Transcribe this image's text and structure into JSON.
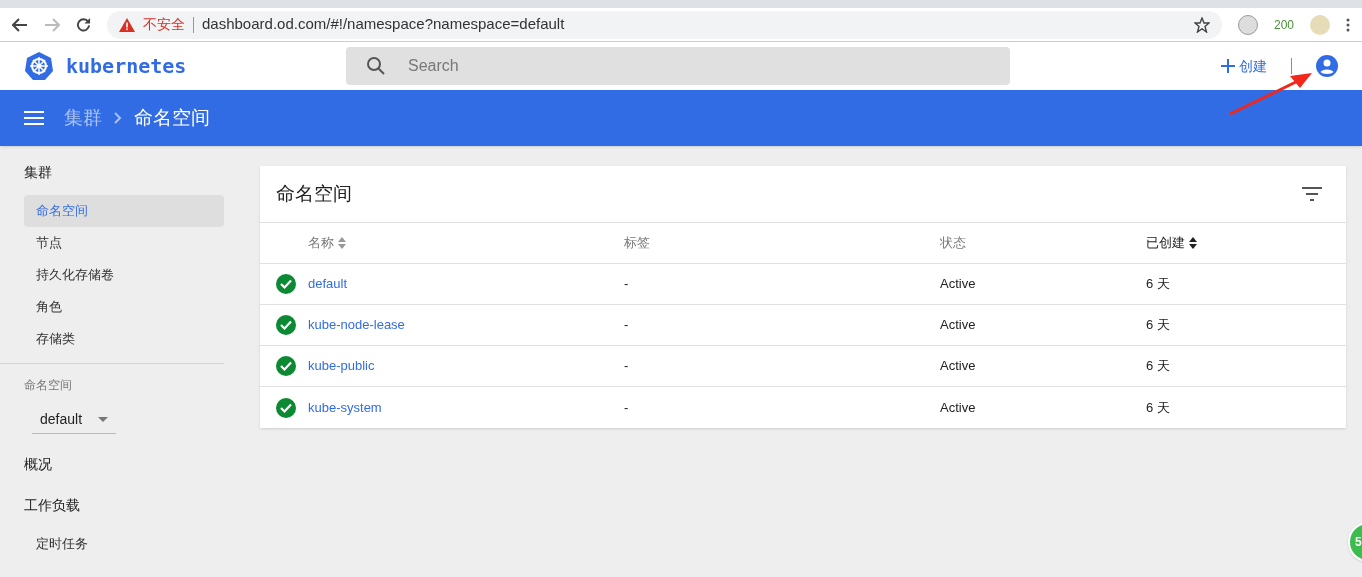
{
  "browser": {
    "security": "不安全",
    "url": "dashboard.od.com/#!/namespace?namespace=default",
    "extension_count": "200"
  },
  "header": {
    "logo": "kubernetes",
    "search": {
      "placeholder": "Search"
    },
    "create": "创建"
  },
  "breadcrumb": [
    "集群",
    "命名空间"
  ],
  "sidebar": {
    "groups": [
      {
        "title": "集群",
        "items": [
          {
            "label": "命名空间",
            "selected": true
          },
          {
            "label": "节点",
            "selected": false
          },
          {
            "label": "持久化存储卷",
            "selected": false
          },
          {
            "label": "角色",
            "selected": false
          },
          {
            "label": "存储类",
            "selected": false
          }
        ]
      }
    ],
    "namespace_label": "命名空间",
    "namespace_value": "default",
    "sections": [
      {
        "title": "概况"
      },
      {
        "title": "工作负载",
        "items": [
          {
            "label": "定时任务",
            "selected": false
          }
        ]
      }
    ]
  },
  "card": {
    "title": "命名空间",
    "columns": [
      {
        "label": "名称",
        "sortable": true,
        "sorted": false
      },
      {
        "label": "标签",
        "sortable": false
      },
      {
        "label": "状态",
        "sortable": false
      },
      {
        "label": "已创建",
        "sortable": true,
        "sorted": true
      }
    ],
    "rows": [
      {
        "healthy": true,
        "name": "default",
        "labels": "-",
        "state": "Active",
        "age": "6 天"
      },
      {
        "healthy": true,
        "name": "kube-node-lease",
        "labels": "-",
        "state": "Active",
        "age": "6 天"
      },
      {
        "healthy": true,
        "name": "kube-public",
        "labels": "-",
        "state": "Active",
        "age": "6 天"
      },
      {
        "healthy": true,
        "name": "kube-system",
        "labels": "-",
        "state": "Active",
        "age": "6 天"
      }
    ]
  },
  "floating_badge": "5"
}
